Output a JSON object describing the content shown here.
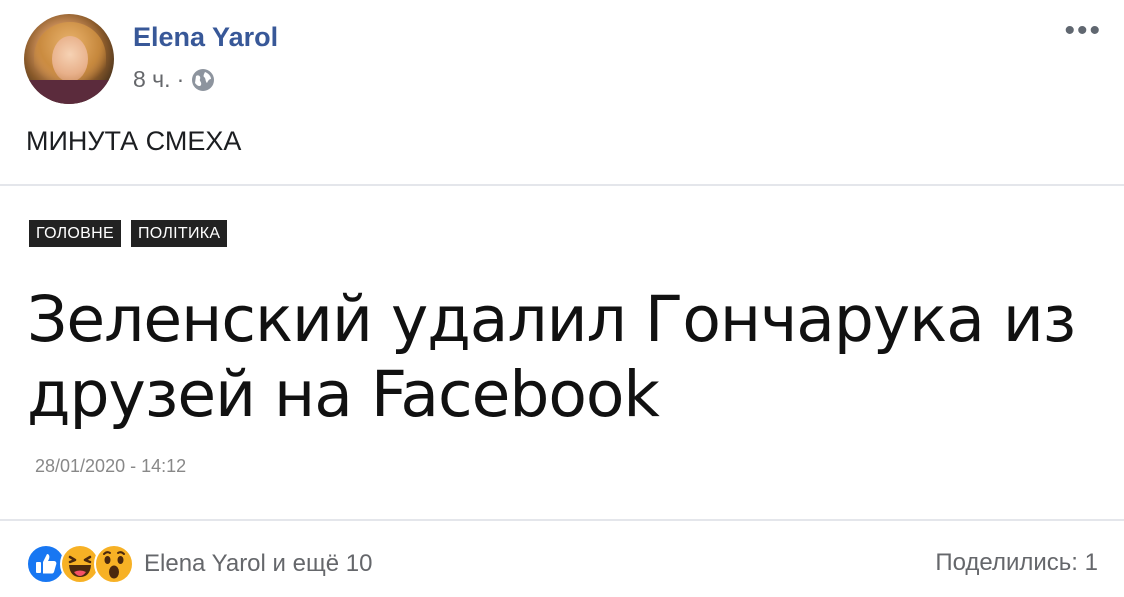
{
  "post": {
    "author": "Elena Yarol",
    "time": "8 ч.",
    "separator": "·",
    "privacy_icon": "globe-icon",
    "text": "МИНУТА СМЕХА"
  },
  "article": {
    "tags": [
      "ГОЛОВНЕ",
      "ПОЛІТИКА"
    ],
    "headline": "Зеленский удалил Гончарука из друзей на Facebook",
    "date": "28/01/2020 - 14:12"
  },
  "footer": {
    "reaction_icons": [
      "like-icon",
      "haha-icon",
      "wow-icon"
    ],
    "reactions_summary": "Elena Yarol и ещё 10",
    "shares": "Поделились: 1"
  },
  "colors": {
    "author_link": "#385898",
    "meta_gray": "#65676b",
    "like_blue": "#1877f2",
    "emoji_yellow": "#f7b125",
    "tag_bg": "#222222"
  }
}
